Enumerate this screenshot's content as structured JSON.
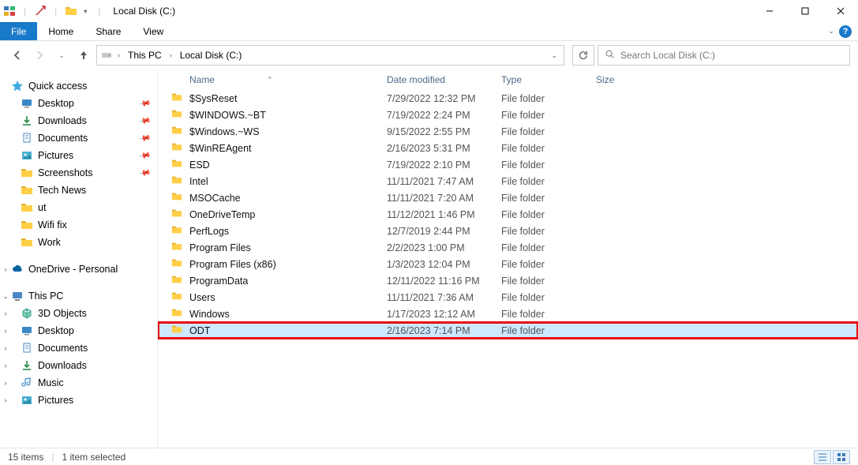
{
  "titlebar": {
    "title": "Local Disk (C:)",
    "buttons": {
      "min": "–",
      "max": "▢",
      "close": "✕"
    }
  },
  "ribbon": {
    "tabs": [
      "File",
      "Home",
      "Share",
      "View"
    ]
  },
  "nav": {
    "breadcrumbs": [
      "This PC",
      "Local Disk (C:)"
    ]
  },
  "search": {
    "placeholder": "Search Local Disk (C:)"
  },
  "sidebar": {
    "quick_access": {
      "label": "Quick access",
      "items": [
        {
          "label": "Desktop",
          "pinned": true,
          "icon": "desktop"
        },
        {
          "label": "Downloads",
          "pinned": true,
          "icon": "downloads"
        },
        {
          "label": "Documents",
          "pinned": true,
          "icon": "documents"
        },
        {
          "label": "Pictures",
          "pinned": true,
          "icon": "pictures"
        },
        {
          "label": "Screenshots",
          "pinned": true,
          "icon": "folder"
        },
        {
          "label": "Tech News",
          "pinned": false,
          "icon": "folder"
        },
        {
          "label": "ut",
          "pinned": false,
          "icon": "folder"
        },
        {
          "label": "Wifi fix",
          "pinned": false,
          "icon": "folder"
        },
        {
          "label": "Work",
          "pinned": false,
          "icon": "folder"
        }
      ]
    },
    "onedrive": {
      "label": "OneDrive - Personal"
    },
    "thispc": {
      "label": "This PC",
      "items": [
        {
          "label": "3D Objects",
          "icon": "3d"
        },
        {
          "label": "Desktop",
          "icon": "desktop"
        },
        {
          "label": "Documents",
          "icon": "documents"
        },
        {
          "label": "Downloads",
          "icon": "downloads"
        },
        {
          "label": "Music",
          "icon": "music"
        },
        {
          "label": "Pictures",
          "icon": "pictures"
        }
      ]
    }
  },
  "columns": {
    "name": "Name",
    "date": "Date modified",
    "type": "Type",
    "size": "Size"
  },
  "rows": [
    {
      "name": "$SysReset",
      "date": "7/29/2022 12:32 PM",
      "type": "File folder"
    },
    {
      "name": "$WINDOWS.~BT",
      "date": "7/19/2022 2:24 PM",
      "type": "File folder"
    },
    {
      "name": "$Windows.~WS",
      "date": "9/15/2022 2:55 PM",
      "type": "File folder"
    },
    {
      "name": "$WinREAgent",
      "date": "2/16/2023 5:31 PM",
      "type": "File folder"
    },
    {
      "name": "ESD",
      "date": "7/19/2022 2:10 PM",
      "type": "File folder"
    },
    {
      "name": "Intel",
      "date": "11/11/2021 7:47 AM",
      "type": "File folder"
    },
    {
      "name": "MSOCache",
      "date": "11/11/2021 7:20 AM",
      "type": "File folder"
    },
    {
      "name": "OneDriveTemp",
      "date": "11/12/2021 1:46 PM",
      "type": "File folder"
    },
    {
      "name": "PerfLogs",
      "date": "12/7/2019 2:44 PM",
      "type": "File folder"
    },
    {
      "name": "Program Files",
      "date": "2/2/2023 1:00 PM",
      "type": "File folder"
    },
    {
      "name": "Program Files (x86)",
      "date": "1/3/2023 12:04 PM",
      "type": "File folder"
    },
    {
      "name": "ProgramData",
      "date": "12/11/2022 11:16 PM",
      "type": "File folder"
    },
    {
      "name": "Users",
      "date": "11/11/2021 7:36 AM",
      "type": "File folder"
    },
    {
      "name": "Windows",
      "date": "1/17/2023 12:12 AM",
      "type": "File folder"
    },
    {
      "name": "ODT",
      "date": "2/16/2023 7:14 PM",
      "type": "File folder",
      "selected": true,
      "highlight": true
    }
  ],
  "status": {
    "count": "15 items",
    "selected": "1 item selected"
  }
}
